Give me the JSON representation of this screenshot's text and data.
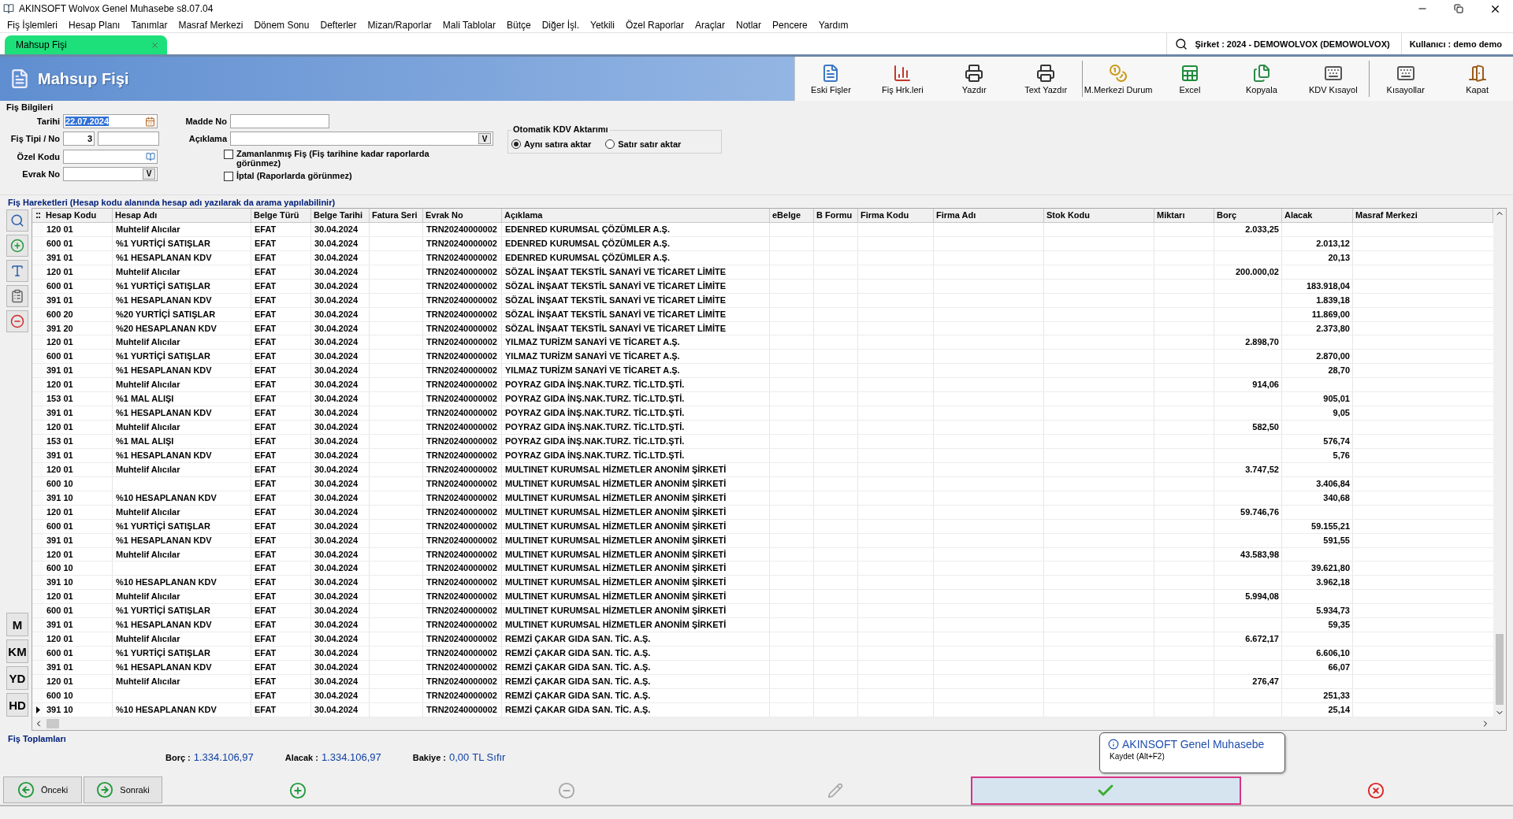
{
  "window": {
    "title": "AKINSOFT Wolvox Genel Muhasebe s8.07.04"
  },
  "menu": [
    "Fiş İşlemleri",
    "Hesap Planı",
    "Tanımlar",
    "Masraf Merkezi",
    "Dönem Sonu",
    "Defterler",
    "Mizan/Raporlar",
    "Mali Tablolar",
    "Bütçe",
    "Diğer İşl.",
    "Yetkili",
    "Özel Raporlar",
    "Araçlar",
    "Notlar",
    "Pencere",
    "Yardım"
  ],
  "tabs": [
    {
      "label": "Mahsup Fişi",
      "selected": true
    }
  ],
  "session": {
    "company": "Şirket : 2024 - DEMOWOLVOX (DEMOWOLVOX)",
    "user": "Kullanıcı : demo demo"
  },
  "form_title": "Mahsup Fişi",
  "toolbar": [
    {
      "label": "Eski Fişler",
      "kind": "file",
      "separator_before": false
    },
    {
      "label": "Fiş Hrk.leri",
      "kind": "chart",
      "separator_before": false
    },
    {
      "label": "Yazdır",
      "kind": "printer",
      "separator_before": false
    },
    {
      "label": "Text Yazdır",
      "kind": "printer",
      "separator_before": false
    },
    {
      "label": "M.Merkezi Durum",
      "kind": "coins",
      "separator_before": true
    },
    {
      "label": "Excel",
      "kind": "sheet",
      "separator_before": false
    },
    {
      "label": "Kopyala",
      "kind": "copy",
      "separator_before": false
    },
    {
      "label": "KDV Kısayol",
      "kind": "keyboard",
      "separator_before": false
    },
    {
      "label": "Kısayollar",
      "kind": "keyboard",
      "separator_before": true
    },
    {
      "label": "Kapat",
      "kind": "door",
      "separator_before": false
    }
  ],
  "fis_bilgileri": {
    "title": "Fiş Bilgileri",
    "tarihi": {
      "label": "Tarihi",
      "value": "22.07.2024",
      "highlighted": true
    },
    "fis_tipi_no": {
      "label": "Fiş Tipi / No",
      "value": "3"
    },
    "ozel_kodu": {
      "label": "Özel Kodu"
    },
    "evrak_no": {
      "label": "Evrak No",
      "button": "V"
    },
    "madde_no": {
      "label": "Madde No"
    },
    "aciklama": {
      "label": "Açıklama",
      "button": "V"
    },
    "checkboxes": [
      {
        "label": "Zamanlanmış Fiş (Fiş tarihine kadar raporlarda görünmez)",
        "checked": false
      },
      {
        "label": "İptal (Raporlarda görünmez)",
        "checked": false
      }
    ],
    "kdv": {
      "title": "Otomatik KDV Aktarımı",
      "options": [
        {
          "label": "Aynı satıra aktar",
          "selected": true
        },
        {
          "label": "Satır satır aktar",
          "selected": false
        }
      ]
    }
  },
  "side_tools": [
    {
      "kind": "search"
    },
    {
      "kind": "add"
    },
    {
      "kind": "font"
    },
    {
      "kind": "clipboard"
    },
    {
      "kind": "remove"
    }
  ],
  "side_keys": [
    "M",
    "KM",
    "YD",
    "HD"
  ],
  "table": {
    "title": "Fiş Hareketleri (Hesap kodu alanında hesap adı yazılarak da arama yapılabilinir)",
    "columns": [
      "Hesap Kodu",
      "Hesap Adı",
      "Belge Türü",
      "Belge Tarihi",
      "Fatura Seri",
      "Evrak No",
      "Açıklama",
      "eBelge",
      "B Formu",
      "Firma Kodu",
      "Firma Adı",
      "Stok Kodu",
      "Miktarı",
      "Borç",
      "Alacak",
      "Masraf Merkezi"
    ],
    "rows": [
      {
        "hesap_kodu": "120 01",
        "hesap_adi": "Muhtelif Alıcılar",
        "belge_turu": "EFAT",
        "belge_tarihi": "30.04.2024",
        "evrak_no": "TRN20240000002",
        "aciklama": "EDENRED KURUMSAL ÇÖZÜMLER A.Ş.",
        "borc": "2.033,25",
        "selected": false
      },
      {
        "hesap_kodu": "600 01",
        "hesap_adi": "%1 YURTİÇİ SATIŞLAR",
        "belge_turu": "EFAT",
        "belge_tarihi": "30.04.2024",
        "evrak_no": "TRN20240000002",
        "aciklama": "EDENRED KURUMSAL ÇÖZÜMLER A.Ş.",
        "alacak": "2.013,12",
        "selected": false
      },
      {
        "hesap_kodu": "391 01",
        "hesap_adi": "%1 HESAPLANAN KDV",
        "belge_turu": "EFAT",
        "belge_tarihi": "30.04.2024",
        "evrak_no": "TRN20240000002",
        "aciklama": "EDENRED KURUMSAL ÇÖZÜMLER A.Ş.",
        "alacak": "20,13",
        "selected": false
      },
      {
        "hesap_kodu": "120 01",
        "hesap_adi": "Muhtelif Alıcılar",
        "belge_turu": "EFAT",
        "belge_tarihi": "30.04.2024",
        "evrak_no": "TRN20240000002",
        "aciklama": "SÖZAL İNŞAAT TEKSTİL SANAYİ VE TİCARET LİMİTE",
        "borc": "200.000,02",
        "selected": false
      },
      {
        "hesap_kodu": "600 01",
        "hesap_adi": "%1 YURTİÇİ SATIŞLAR",
        "belge_turu": "EFAT",
        "belge_tarihi": "30.04.2024",
        "evrak_no": "TRN20240000002",
        "aciklama": "SÖZAL İNŞAAT TEKSTİL SANAYİ VE TİCARET LİMİTE",
        "alacak": "183.918,04",
        "selected": false
      },
      {
        "hesap_kodu": "391 01",
        "hesap_adi": "%1 HESAPLANAN KDV",
        "belge_turu": "EFAT",
        "belge_tarihi": "30.04.2024",
        "evrak_no": "TRN20240000002",
        "aciklama": "SÖZAL İNŞAAT TEKSTİL SANAYİ VE TİCARET LİMİTE",
        "alacak": "1.839,18",
        "selected": false
      },
      {
        "hesap_kodu": "600 20",
        "hesap_adi": "%20 YURTİÇİ SATIŞLAR",
        "belge_turu": "EFAT",
        "belge_tarihi": "30.04.2024",
        "evrak_no": "TRN20240000002",
        "aciklama": "SÖZAL İNŞAAT TEKSTİL SANAYİ VE TİCARET LİMİTE",
        "alacak": "11.869,00",
        "selected": false
      },
      {
        "hesap_kodu": "391 20",
        "hesap_adi": "%20 HESAPLANAN KDV",
        "belge_turu": "EFAT",
        "belge_tarihi": "30.04.2024",
        "evrak_no": "TRN20240000002",
        "aciklama": "SÖZAL İNŞAAT TEKSTİL SANAYİ VE TİCARET LİMİTE",
        "alacak": "2.373,80",
        "selected": false
      },
      {
        "hesap_kodu": "120 01",
        "hesap_adi": "Muhtelif Alıcılar",
        "belge_turu": "EFAT",
        "belge_tarihi": "30.04.2024",
        "evrak_no": "TRN20240000002",
        "aciklama": "YILMAZ TURİZM SANAYİ VE TİCARET A.Ş.",
        "borc": "2.898,70",
        "selected": false
      },
      {
        "hesap_kodu": "600 01",
        "hesap_adi": "%1 YURTİÇİ SATIŞLAR",
        "belge_turu": "EFAT",
        "belge_tarihi": "30.04.2024",
        "evrak_no": "TRN20240000002",
        "aciklama": "YILMAZ TURİZM SANAYİ VE TİCARET A.Ş.",
        "alacak": "2.870,00",
        "selected": false
      },
      {
        "hesap_kodu": "391 01",
        "hesap_adi": "%1 HESAPLANAN KDV",
        "belge_turu": "EFAT",
        "belge_tarihi": "30.04.2024",
        "evrak_no": "TRN20240000002",
        "aciklama": "YILMAZ TURİZM SANAYİ VE TİCARET A.Ş.",
        "alacak": "28,70",
        "selected": false
      },
      {
        "hesap_kodu": "120 01",
        "hesap_adi": "Muhtelif Alıcılar",
        "belge_turu": "EFAT",
        "belge_tarihi": "30.04.2024",
        "evrak_no": "TRN20240000002",
        "aciklama": "POYRAZ GIDA İNŞ.NAK.TURZ. TİC.LTD.ŞTİ.",
        "borc": "914,06",
        "selected": false
      },
      {
        "hesap_kodu": "153 01",
        "hesap_adi": "%1 MAL ALIŞI",
        "belge_turu": "EFAT",
        "belge_tarihi": "30.04.2024",
        "evrak_no": "TRN20240000002",
        "aciklama": "POYRAZ GIDA İNŞ.NAK.TURZ. TİC.LTD.ŞTİ.",
        "alacak": "905,01",
        "selected": false
      },
      {
        "hesap_kodu": "391 01",
        "hesap_adi": "%1 HESAPLANAN KDV",
        "belge_turu": "EFAT",
        "belge_tarihi": "30.04.2024",
        "evrak_no": "TRN20240000002",
        "aciklama": "POYRAZ GIDA İNŞ.NAK.TURZ. TİC.LTD.ŞTİ.",
        "alacak": "9,05",
        "selected": false
      },
      {
        "hesap_kodu": "120 01",
        "hesap_adi": "Muhtelif Alıcılar",
        "belge_turu": "EFAT",
        "belge_tarihi": "30.04.2024",
        "evrak_no": "TRN20240000002",
        "aciklama": "POYRAZ GIDA İNŞ.NAK.TURZ. TİC.LTD.ŞTİ.",
        "borc": "582,50",
        "selected": false
      },
      {
        "hesap_kodu": "153 01",
        "hesap_adi": "%1 MAL ALIŞI",
        "belge_turu": "EFAT",
        "belge_tarihi": "30.04.2024",
        "evrak_no": "TRN20240000002",
        "aciklama": "POYRAZ GIDA İNŞ.NAK.TURZ. TİC.LTD.ŞTİ.",
        "alacak": "576,74",
        "selected": false
      },
      {
        "hesap_kodu": "391 01",
        "hesap_adi": "%1 HESAPLANAN KDV",
        "belge_turu": "EFAT",
        "belge_tarihi": "30.04.2024",
        "evrak_no": "TRN20240000002",
        "aciklama": "POYRAZ GIDA İNŞ.NAK.TURZ. TİC.LTD.ŞTİ.",
        "alacak": "5,76",
        "selected": false
      },
      {
        "hesap_kodu": "120 01",
        "hesap_adi": "Muhtelif Alıcılar",
        "belge_turu": "EFAT",
        "belge_tarihi": "30.04.2024",
        "evrak_no": "TRN20240000002",
        "aciklama": "MULTINET KURUMSAL HİZMETLER ANONİM ŞİRKETİ",
        "borc": "3.747,52",
        "selected": false
      },
      {
        "hesap_kodu": "600 10",
        "belge_turu": "EFAT",
        "belge_tarihi": "30.04.2024",
        "evrak_no": "TRN20240000002",
        "aciklama": "MULTINET KURUMSAL HİZMETLER ANONİM ŞİRKETİ",
        "alacak": "3.406,84",
        "selected": false
      },
      {
        "hesap_kodu": "391 10",
        "hesap_adi": "%10 HESAPLANAN KDV",
        "belge_turu": "EFAT",
        "belge_tarihi": "30.04.2024",
        "evrak_no": "TRN20240000002",
        "aciklama": "MULTINET KURUMSAL HİZMETLER ANONİM ŞİRKETİ",
        "alacak": "340,68",
        "selected": false
      },
      {
        "hesap_kodu": "120 01",
        "hesap_adi": "Muhtelif Alıcılar",
        "belge_turu": "EFAT",
        "belge_tarihi": "30.04.2024",
        "evrak_no": "TRN20240000002",
        "aciklama": "MULTINET KURUMSAL HİZMETLER ANONİM ŞİRKETİ",
        "borc": "59.746,76",
        "selected": false
      },
      {
        "hesap_kodu": "600 01",
        "hesap_adi": "%1 YURTİÇİ SATIŞLAR",
        "belge_turu": "EFAT",
        "belge_tarihi": "30.04.2024",
        "evrak_no": "TRN20240000002",
        "aciklama": "MULTINET KURUMSAL HİZMETLER ANONİM ŞİRKETİ",
        "alacak": "59.155,21",
        "selected": false
      },
      {
        "hesap_kodu": "391 01",
        "hesap_adi": "%1 HESAPLANAN KDV",
        "belge_turu": "EFAT",
        "belge_tarihi": "30.04.2024",
        "evrak_no": "TRN20240000002",
        "aciklama": "MULTINET KURUMSAL HİZMETLER ANONİM ŞİRKETİ",
        "alacak": "591,55",
        "selected": false
      },
      {
        "hesap_kodu": "120 01",
        "hesap_adi": "Muhtelif Alıcılar",
        "belge_turu": "EFAT",
        "belge_tarihi": "30.04.2024",
        "evrak_no": "TRN20240000002",
        "aciklama": "MULTINET KURUMSAL HİZMETLER ANONİM ŞİRKETİ",
        "borc": "43.583,98",
        "selected": false
      },
      {
        "hesap_kodu": "600 10",
        "belge_turu": "EFAT",
        "belge_tarihi": "30.04.2024",
        "evrak_no": "TRN20240000002",
        "aciklama": "MULTINET KURUMSAL HİZMETLER ANONİM ŞİRKETİ",
        "alacak": "39.621,80",
        "selected": false
      },
      {
        "hesap_kodu": "391 10",
        "hesap_adi": "%10 HESAPLANAN KDV",
        "belge_turu": "EFAT",
        "belge_tarihi": "30.04.2024",
        "evrak_no": "TRN20240000002",
        "aciklama": "MULTINET KURUMSAL HİZMETLER ANONİM ŞİRKETİ",
        "alacak": "3.962,18",
        "selected": false
      },
      {
        "hesap_kodu": "120 01",
        "hesap_adi": "Muhtelif Alıcılar",
        "belge_turu": "EFAT",
        "belge_tarihi": "30.04.2024",
        "evrak_no": "TRN20240000002",
        "aciklama": "MULTINET KURUMSAL HİZMETLER ANONİM ŞİRKETİ",
        "borc": "5.994,08",
        "selected": false
      },
      {
        "hesap_kodu": "600 01",
        "hesap_adi": "%1 YURTİÇİ SATIŞLAR",
        "belge_turu": "EFAT",
        "belge_tarihi": "30.04.2024",
        "evrak_no": "TRN20240000002",
        "aciklama": "MULTINET KURUMSAL HİZMETLER ANONİM ŞİRKETİ",
        "alacak": "5.934,73",
        "selected": false
      },
      {
        "hesap_kodu": "391 01",
        "hesap_adi": "%1 HESAPLANAN KDV",
        "belge_turu": "EFAT",
        "belge_tarihi": "30.04.2024",
        "evrak_no": "TRN20240000002",
        "aciklama": "MULTINET KURUMSAL HİZMETLER ANONİM ŞİRKETİ",
        "alacak": "59,35",
        "selected": false
      },
      {
        "hesap_kodu": "120 01",
        "hesap_adi": "Muhtelif Alıcılar",
        "belge_turu": "EFAT",
        "belge_tarihi": "30.04.2024",
        "evrak_no": "TRN20240000002",
        "aciklama": "REMZİ ÇAKAR GIDA SAN. TİC. A.Ş.",
        "borc": "6.672,17",
        "selected": false
      },
      {
        "hesap_kodu": "600 01",
        "hesap_adi": "%1 YURTİÇİ SATIŞLAR",
        "belge_turu": "EFAT",
        "belge_tarihi": "30.04.2024",
        "evrak_no": "TRN20240000002",
        "aciklama": "REMZİ ÇAKAR GIDA SAN. TİC. A.Ş.",
        "alacak": "6.606,10",
        "selected": false
      },
      {
        "hesap_kodu": "391 01",
        "hesap_adi": "%1 HESAPLANAN KDV",
        "belge_turu": "EFAT",
        "belge_tarihi": "30.04.2024",
        "evrak_no": "TRN20240000002",
        "aciklama": "REMZİ ÇAKAR GIDA SAN. TİC. A.Ş.",
        "alacak": "66,07",
        "selected": false
      },
      {
        "hesap_kodu": "120 01",
        "hesap_adi": "Muhtelif Alıcılar",
        "belge_turu": "EFAT",
        "belge_tarihi": "30.04.2024",
        "evrak_no": "TRN20240000002",
        "aciklama": "REMZİ ÇAKAR GIDA SAN. TİC. A.Ş.",
        "borc": "276,47",
        "selected": false
      },
      {
        "hesap_kodu": "600 10",
        "belge_turu": "EFAT",
        "belge_tarihi": "30.04.2024",
        "evrak_no": "TRN20240000002",
        "aciklama": "REMZİ ÇAKAR GIDA SAN. TİC. A.Ş.",
        "alacak": "251,33",
        "selected": false
      },
      {
        "hesap_kodu": "391 10",
        "hesap_adi": "%10 HESAPLANAN KDV",
        "belge_turu": "EFAT",
        "belge_tarihi": "30.04.2024",
        "evrak_no": "TRN20240000002",
        "aciklama": "REMZİ ÇAKAR GIDA SAN. TİC. A.Ş.",
        "alacak": "25,14",
        "selected": true
      }
    ]
  },
  "totals": {
    "title": "Fiş Toplamları",
    "borc_label": "Borç :",
    "borc": "1.334.106,97",
    "alacak_label": "Alacak :",
    "alacak": "1.334.106,97",
    "bakiye_label": "Bakiye :",
    "bakiye": "0,00",
    "bakiye_text": "TL Sıfır"
  },
  "buttons": [
    {
      "kind": "prev",
      "label": "Önceki",
      "disabled": false
    },
    {
      "kind": "next",
      "label": "Sonraki",
      "disabled": false
    },
    {
      "kind": "add",
      "disabled": false,
      "focused": false
    },
    {
      "kind": "remove",
      "disabled": true,
      "focused": false
    },
    {
      "kind": "edit",
      "disabled": true,
      "focused": false
    },
    {
      "kind": "save",
      "disabled": false,
      "focused": true
    },
    {
      "kind": "cancel",
      "disabled": false,
      "focused": false
    }
  ],
  "tooltip": {
    "title": "AKINSOFT Genel Muhasebe",
    "text": "Kaydet (Alt+F2)"
  }
}
